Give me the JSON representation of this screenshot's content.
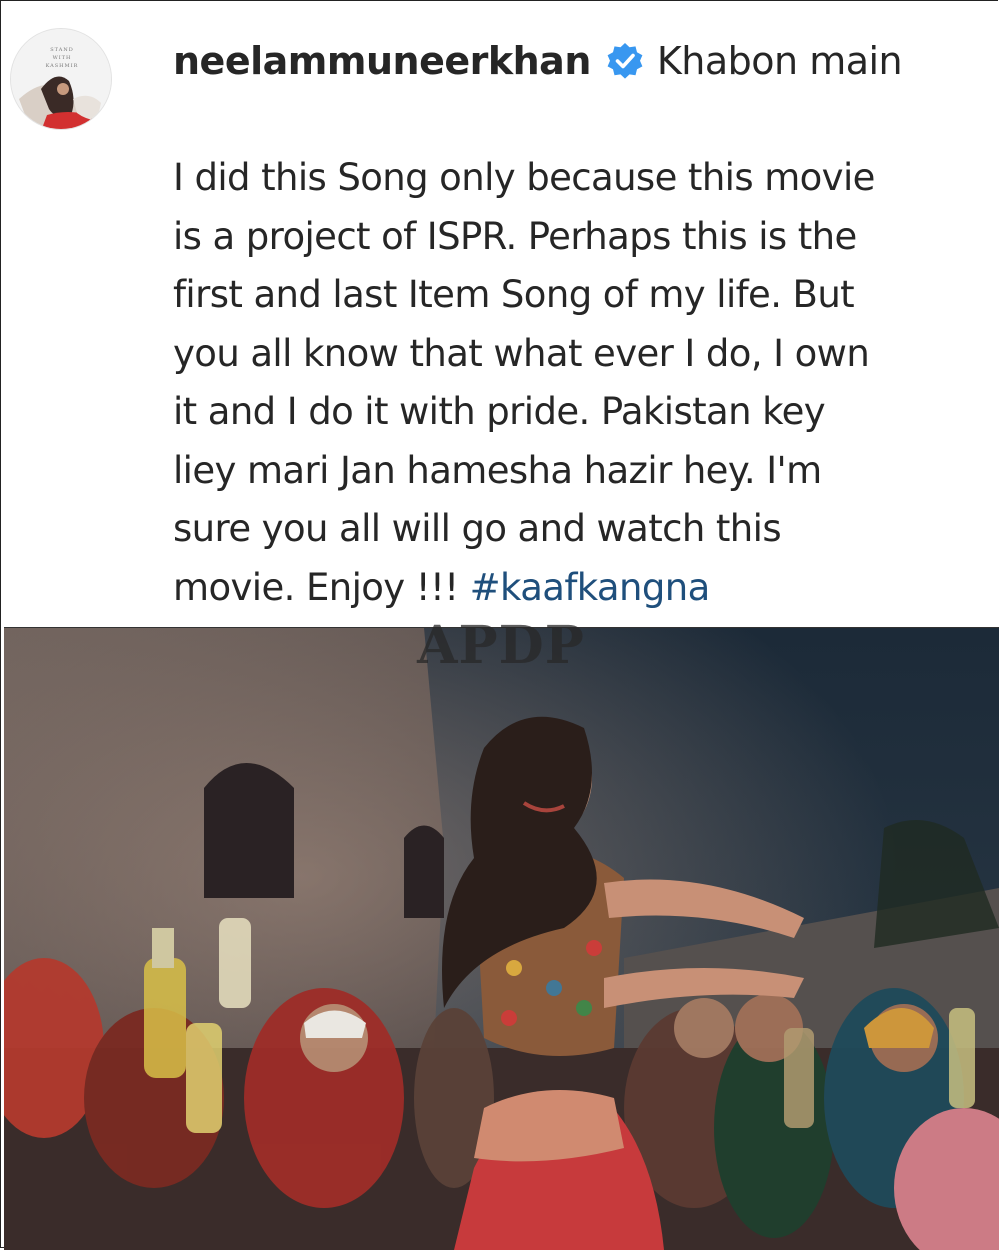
{
  "post": {
    "username": "neelammuneerkhan",
    "headline": "Khabon main",
    "caption_lines": [
      "I did this Song only because this movie",
      "is a project of ISPR. Perhaps this is the",
      "first and last Item Song of my life. But",
      "you all know that what ever I do, I own",
      "it and I do it with pride. Pakistan key",
      "liey mari Jan hamesha hazir hey. I'm",
      "sure you all will go and watch this"
    ],
    "caption_last_prefix": "movie. Enjoy !!! ",
    "hashtag": "#kaafkangna"
  },
  "avatar": {
    "lettering": "STAND WITH KASHMIR"
  },
  "watermark": "APDP",
  "icons": {
    "verified": "verified-badge-icon"
  },
  "colors": {
    "hashtag": "#1f4f7c",
    "verified": "#3897f0",
    "text": "#262626"
  }
}
